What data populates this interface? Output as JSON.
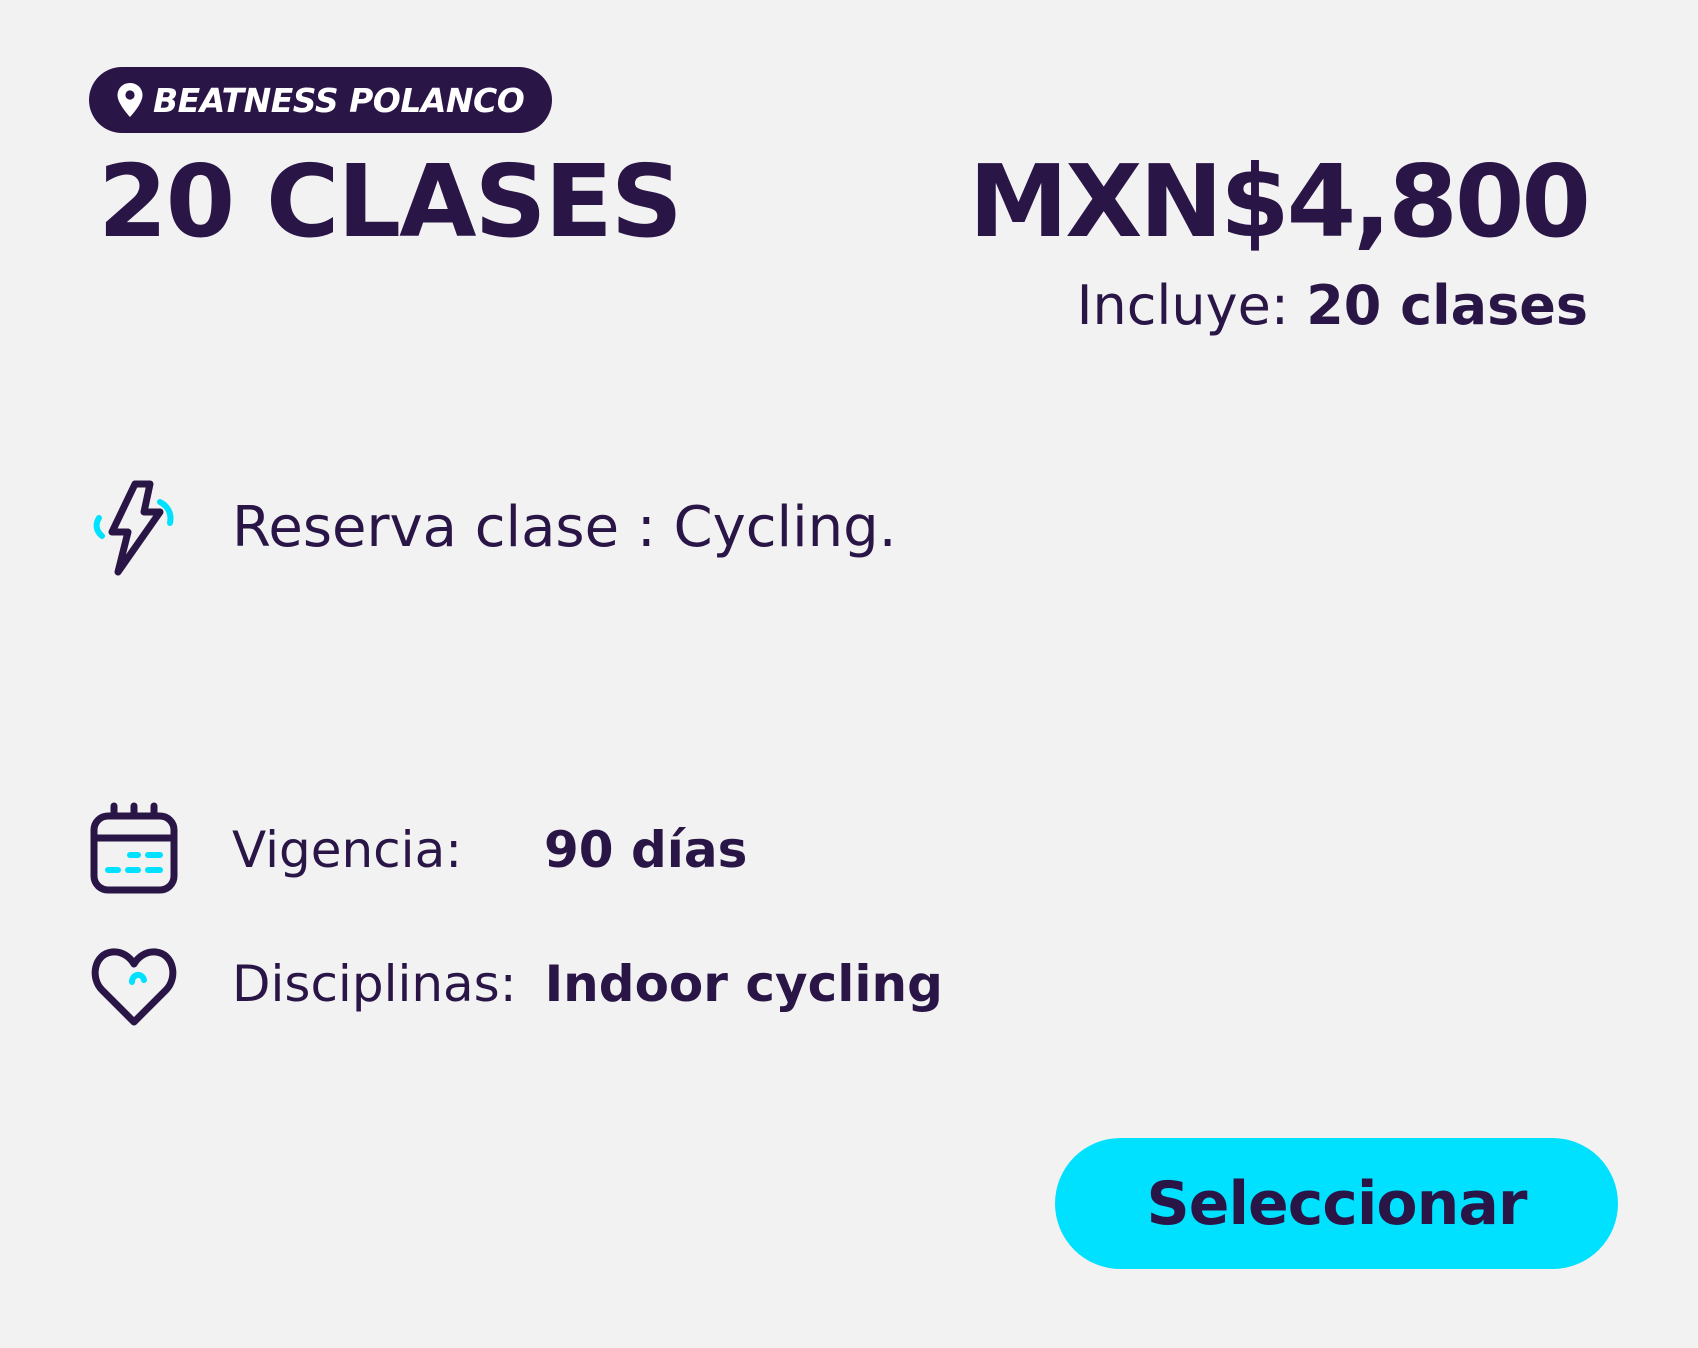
{
  "plan": {
    "location": "BEATNESS POLANCO",
    "title": "20 CLASES",
    "price": "MXN$4,800",
    "includes_label": "Incluye:",
    "includes_value": "20 clases"
  },
  "features": {
    "reserva": {
      "icon": "lightning-bolt-icon",
      "text": "Reserva clase :  Cycling."
    },
    "vigencia": {
      "icon": "calendar-icon",
      "label": "Vigencia:",
      "value": "90 días"
    },
    "disciplinas": {
      "icon": "heart-icon",
      "label": "Disciplinas:",
      "value": "Indoor cycling"
    }
  },
  "actions": {
    "select_label": "Seleccionar"
  },
  "colors": {
    "primary": "#2a1547",
    "accent": "#00e1ff",
    "background": "#f2f2f2"
  }
}
